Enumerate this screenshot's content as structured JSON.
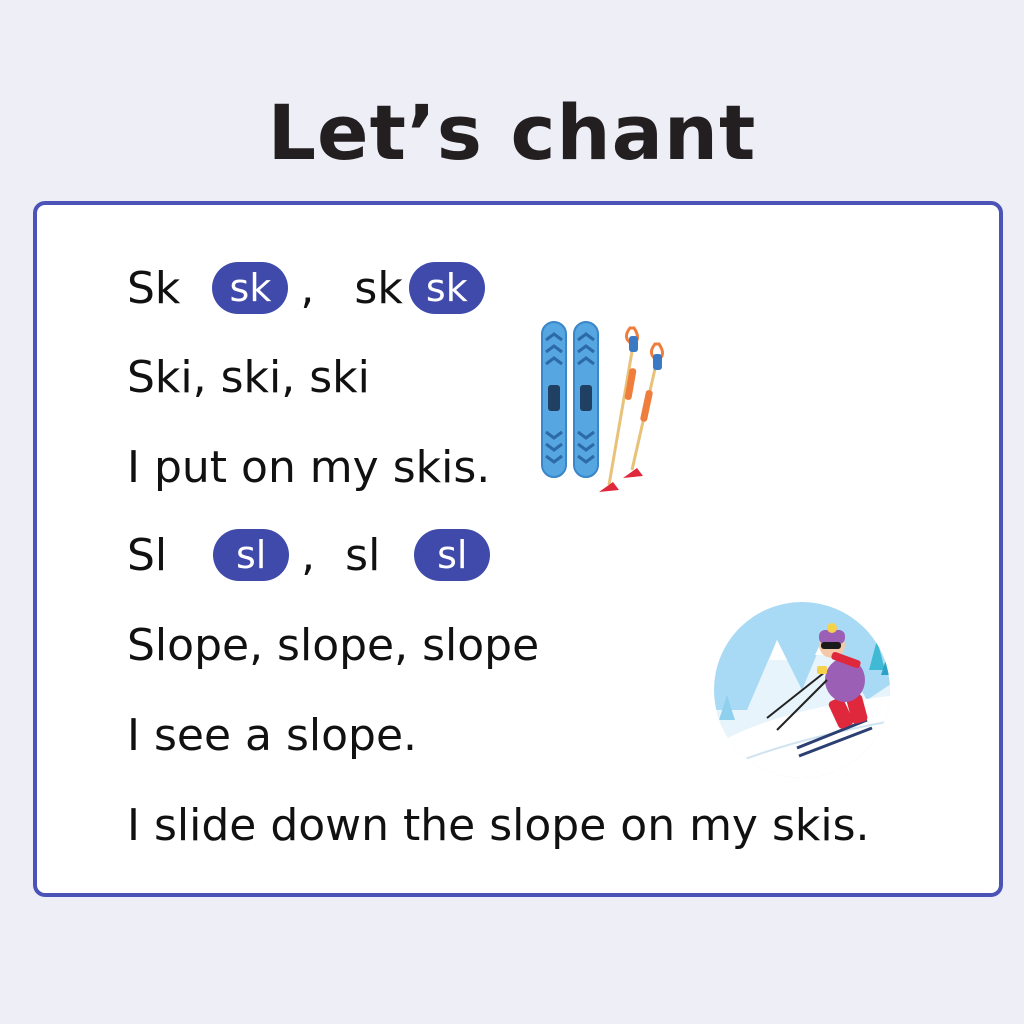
{
  "title": "Let’s chant",
  "lines": {
    "l1": {
      "word1": "Sk",
      "pill1": "sk",
      "comma": ",",
      "word2": "sk",
      "pill2": "sk"
    },
    "l2": "Ski, ski, ski",
    "l3": "I put on my skis.",
    "l4": {
      "word1": "Sl",
      "pill1": "sl",
      "comma": ",",
      "word2": "sl",
      "pill2": "sl"
    },
    "l5": "Slope, slope, slope",
    "l6": "I see a slope.",
    "l7": "I slide down the slope on my skis."
  },
  "illustrations": {
    "skis": "skis-and-poles-icon",
    "skier": "skier-on-slope-illustration"
  },
  "colors": {
    "background": "#eeeef7",
    "card_border": "#4b54b6",
    "pill": "#3f4aab",
    "text": "#111111"
  }
}
